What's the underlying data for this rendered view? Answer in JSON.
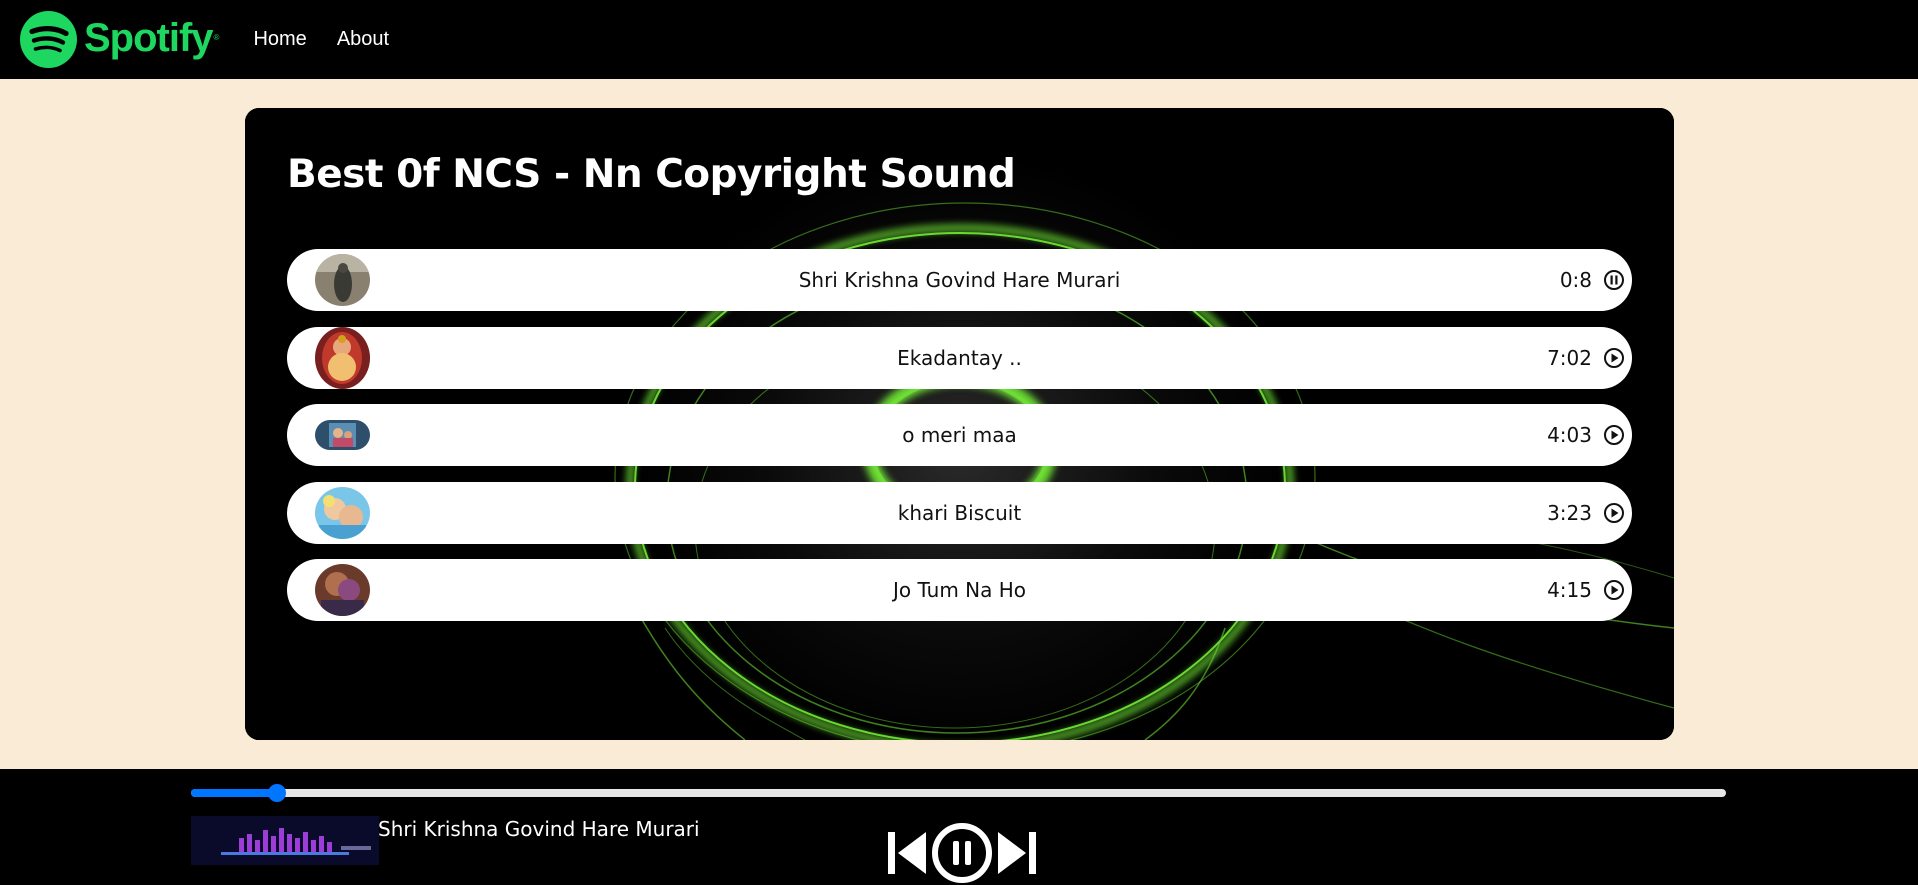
{
  "nav": {
    "brand": "Spotify",
    "brand_mark": "®",
    "links": [
      "Home",
      "About"
    ]
  },
  "playlist": {
    "heading": "Best 0f NCS - Nn Copyright Sound",
    "songs": [
      {
        "name": "Shri Krishna Govind Hare Murari",
        "duration": "0:8",
        "icon": "pause-circle-icon"
      },
      {
        "name": "Ekadantay ..",
        "duration": "7:02",
        "icon": "play-circle-icon"
      },
      {
        "name": "o meri maa",
        "duration": "4:03",
        "icon": "play-circle-icon"
      },
      {
        "name": "khari Biscuit",
        "duration": "3:23",
        "icon": "play-circle-icon"
      },
      {
        "name": "Jo Tum Na Ho",
        "duration": "4:15",
        "icon": "play-circle-icon"
      }
    ]
  },
  "player": {
    "progress_percent": 5.6,
    "now_playing": "Shri Krishna Govind Hare Murari",
    "controls": [
      "backward-step-icon",
      "pause-circle-icon",
      "forward-step-icon"
    ]
  },
  "colors": {
    "brand_green": "#1ed760",
    "page_bg": "#faebd7",
    "accent_blue": "#0075ff",
    "glow_green": "#7cff3a"
  }
}
